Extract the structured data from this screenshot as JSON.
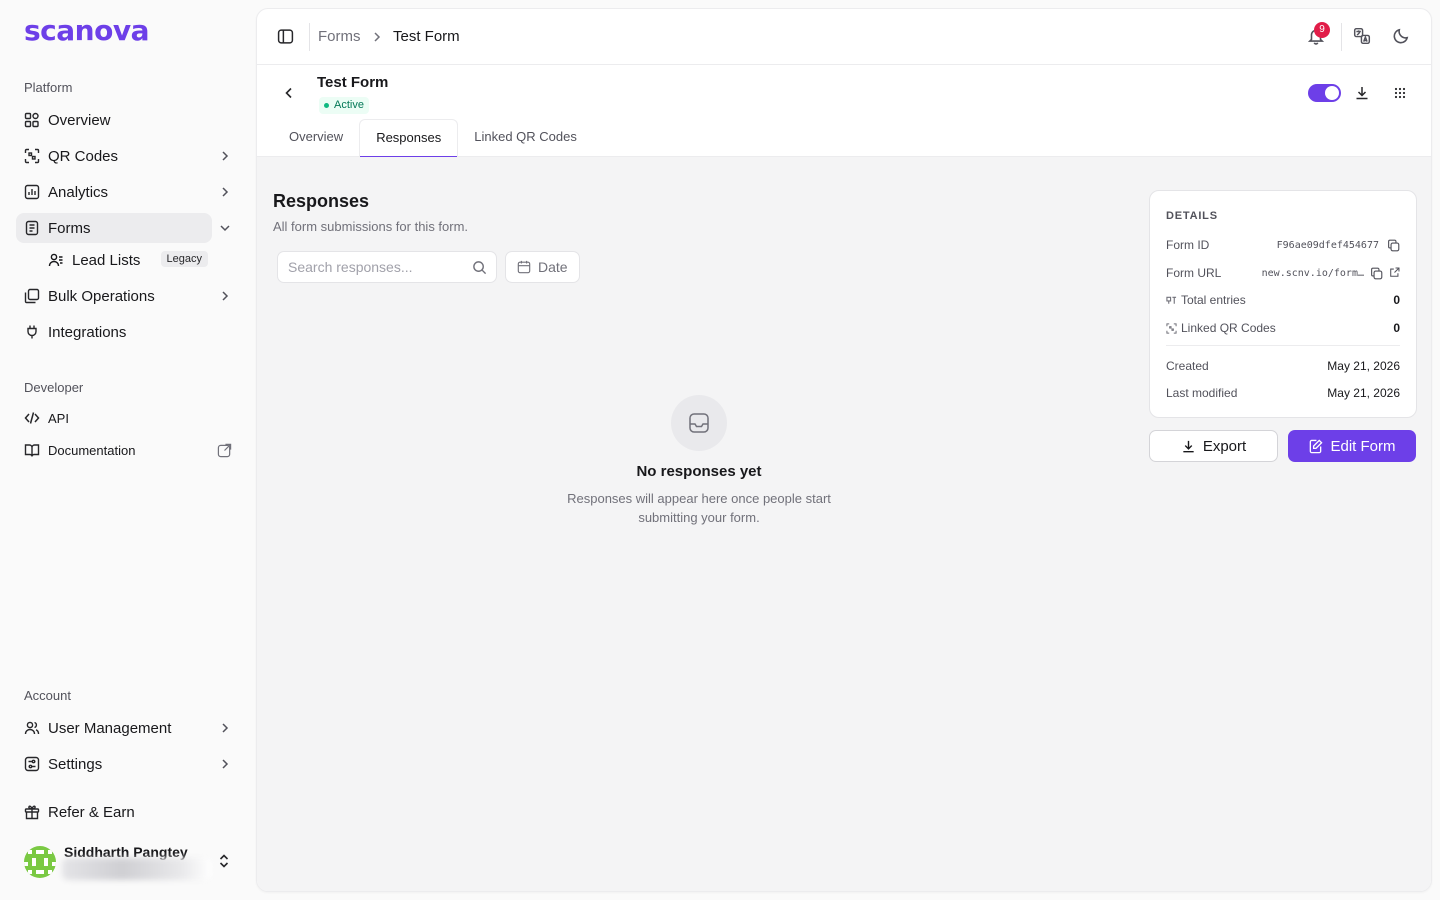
{
  "brand": {
    "logo_text": "scanova",
    "accent": "#6d3fe8"
  },
  "sidebar": {
    "platform_label": "Platform",
    "items": [
      {
        "label": "Overview",
        "icon": "dashboard-icon"
      },
      {
        "label": "QR Codes",
        "icon": "qr-scan-icon"
      },
      {
        "label": "Analytics",
        "icon": "bar-chart-icon"
      },
      {
        "label": "Forms",
        "icon": "form-icon"
      },
      {
        "label": "Bulk Operations",
        "icon": "stack-icon"
      },
      {
        "label": "Integrations",
        "icon": "plug-icon"
      }
    ],
    "sub_items": [
      {
        "label": "Lead Lists",
        "badge": "Legacy",
        "icon": "user-list-icon"
      }
    ],
    "developer_label": "Developer",
    "dev_items": [
      {
        "label": "API",
        "icon": "code-icon"
      },
      {
        "label": "Documentation",
        "icon": "book-icon"
      }
    ],
    "account_label": "Account",
    "account_items": [
      {
        "label": "User Management",
        "icon": "users-icon"
      },
      {
        "label": "Settings",
        "icon": "sliders-icon"
      }
    ],
    "refer_label": "Refer & Earn",
    "user": {
      "name": "Siddharth Pangtey"
    }
  },
  "topbar": {
    "breadcrumb_parent": "Forms",
    "breadcrumb_current": "Test Form",
    "notification_count": "9"
  },
  "form": {
    "title": "Test Form",
    "status": "Active",
    "tabs": [
      "Overview",
      "Responses",
      "Linked QR Codes"
    ],
    "active_tab": "Responses"
  },
  "responses": {
    "title": "Responses",
    "subtitle": "All form submissions for this form.",
    "search_placeholder": "Search responses...",
    "date_label": "Date",
    "empty_title": "No responses yet",
    "empty_desc": "Responses will appear here once people start submitting your form."
  },
  "details": {
    "heading": "DETAILS",
    "form_id_label": "Form ID",
    "form_id": "F96ae09dfef454677",
    "form_url_label": "Form URL",
    "form_url": "new.scnv.io/form…",
    "total_entries_label": "Total entries",
    "total_entries": "0",
    "linked_qr_label": "Linked QR Codes",
    "linked_qr": "0",
    "created_label": "Created",
    "created": "May 21, 2026",
    "modified_label": "Last modified",
    "modified": "May 21, 2026"
  },
  "actions": {
    "export_label": "Export",
    "edit_label": "Edit Form"
  }
}
